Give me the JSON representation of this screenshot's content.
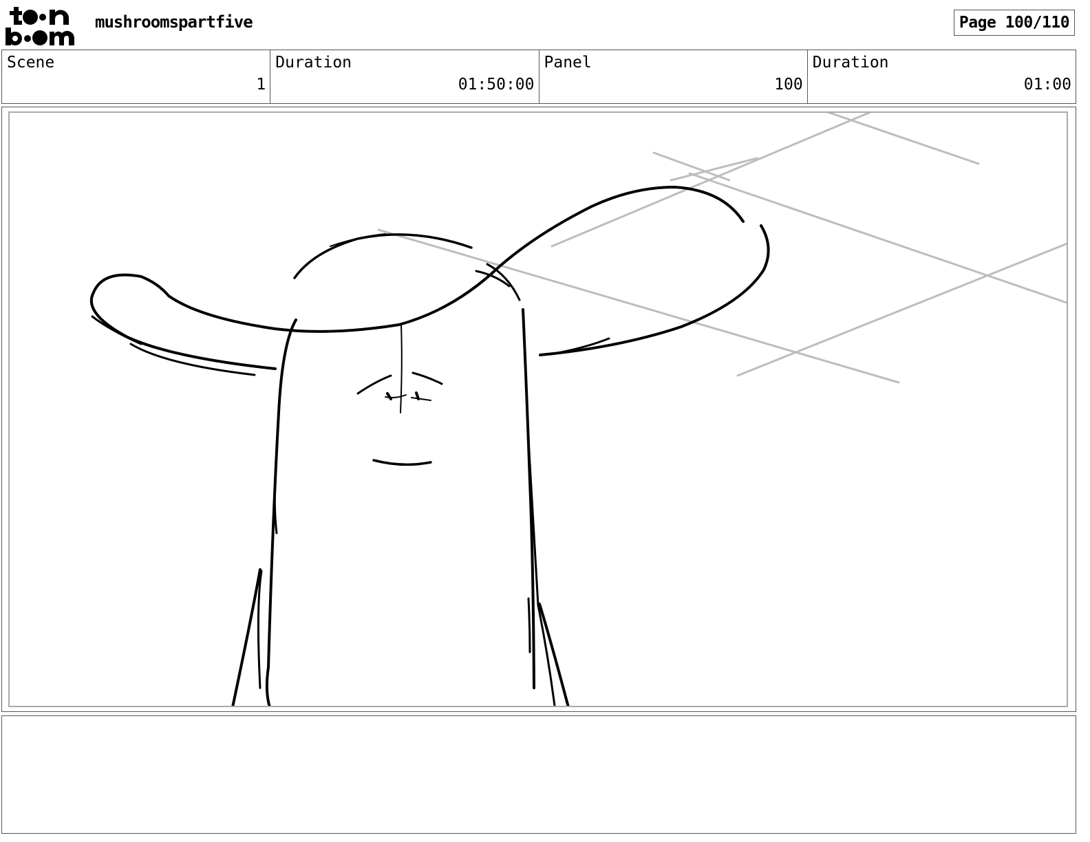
{
  "logo": {
    "icon": "toonboom-logo",
    "line1": "toon",
    "line2": "boom"
  },
  "project_title": "mushroomspartfive",
  "page_indicator": "Page 100/110",
  "info_bar": [
    {
      "label": "Scene",
      "value": "1"
    },
    {
      "label": "Duration",
      "value": "01:50:00"
    },
    {
      "label": "Panel",
      "value": "100"
    },
    {
      "label": "Duration",
      "value": "01:00"
    }
  ],
  "panel": {
    "drawing": "mushroom-character-sketch"
  },
  "notes": {
    "text": ""
  }
}
